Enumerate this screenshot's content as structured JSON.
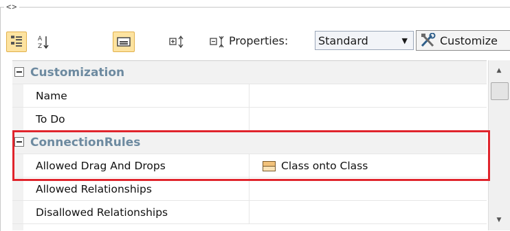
{
  "panel": {
    "collapse_glyph": "<>"
  },
  "toolbar": {
    "buttons": [
      {
        "name": "categorized-view-button",
        "icon": "categorized-icon",
        "toggled": true
      },
      {
        "name": "alphabetical-sort-button",
        "icon": "sort-az-icon",
        "toggled": false
      },
      {
        "name": "description-pane-button",
        "icon": "description-pane-icon",
        "toggled": true
      },
      {
        "name": "expand-all-button",
        "icon": "expand-all-icon",
        "toggled": false
      },
      {
        "name": "collapse-all-button",
        "icon": "collapse-all-icon",
        "toggled": false
      }
    ],
    "properties_label": "Properties:",
    "properties_value": "Standard",
    "customize_label": "Customize"
  },
  "grid": {
    "rows": [
      {
        "type": "group",
        "label": "Customization"
      },
      {
        "type": "prop",
        "name": "Name",
        "value": ""
      },
      {
        "type": "prop",
        "name": "To Do",
        "value": ""
      },
      {
        "type": "group",
        "label": "ConnectionRules"
      },
      {
        "type": "prop",
        "name": "Allowed Drag And Drops",
        "value": "Class onto Class",
        "icon": "class-icon"
      },
      {
        "type": "prop",
        "name": "Allowed Relationships",
        "value": ""
      },
      {
        "type": "prop",
        "name": "Disallowed Relationships",
        "value": ""
      }
    ]
  },
  "colors": {
    "highlight": "#e0242c",
    "group_title": "#6d8aa0",
    "toggled_bg": "#fde3a0"
  }
}
